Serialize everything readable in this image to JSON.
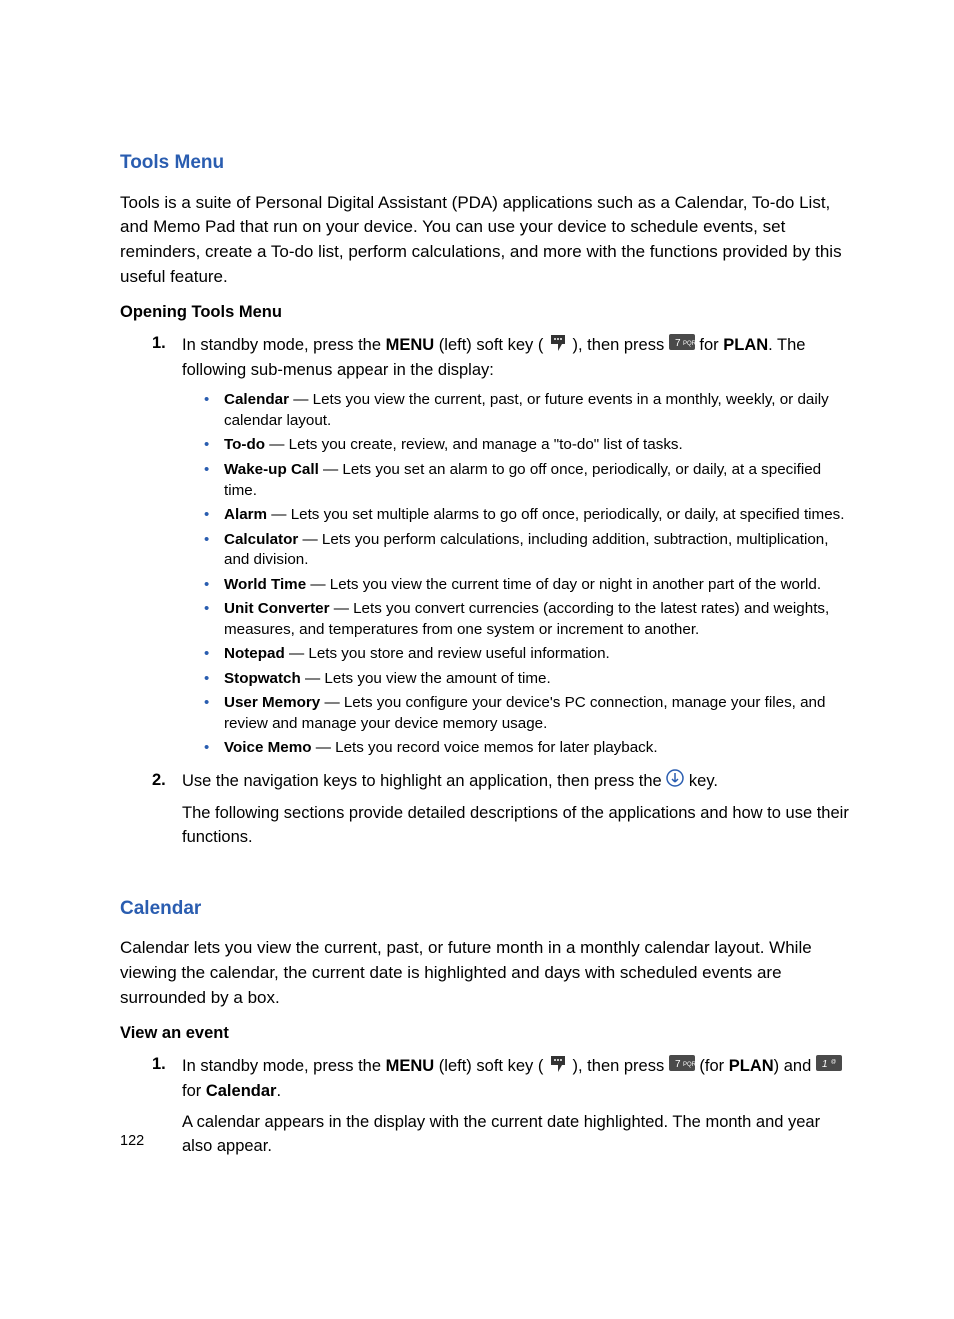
{
  "pageNumber": "122",
  "toolsMenu": {
    "heading": "Tools Menu",
    "intro": "Tools is a suite of Personal Digital Assistant (PDA) applications such as a Calendar, To-do List, and Memo Pad that run on your device. You can use your device to schedule events, set reminders, create a To-do list, perform calculations, and more with the functions provided by this useful feature.",
    "subheading": "Opening Tools Menu",
    "step1": {
      "text_a": "In standby mode, press the ",
      "menu_bold": "MENU",
      "text_b": " (left) soft key (",
      "text_c": "), then press ",
      "text_d": " for ",
      "plan_bold": "PLAN",
      "text_e": ". The following sub-menus appear in the display:"
    },
    "submenus": [
      {
        "name": "Calendar",
        "desc": " — Lets you view the current, past, or future events in a monthly, weekly, or daily calendar layout."
      },
      {
        "name": "To-do",
        "desc": " — Lets you create, review, and manage a \"to-do\" list of tasks."
      },
      {
        "name": "Wake-up Call",
        "desc": " — Lets you set an alarm to go off once, periodically, or daily, at a specified time."
      },
      {
        "name": "Alarm",
        "desc": " — Lets you set multiple alarms to go off once, periodically, or daily, at specified times."
      },
      {
        "name": "Calculator",
        "desc": " — Lets you perform calculations, including addition, subtraction, multiplication, and division."
      },
      {
        "name": "World Time",
        "desc": " — Lets you view the current time of day or night in another part of the world."
      },
      {
        "name": "Unit Converter",
        "desc": " — Lets you convert currencies (according to the latest rates) and weights, measures, and temperatures from one system or increment to another."
      },
      {
        "name": "Notepad",
        "desc": " — Lets you store and review useful information."
      },
      {
        "name": "Stopwatch",
        "desc": " — Lets you view the amount of time."
      },
      {
        "name": "User Memory",
        "desc": " — Lets you configure your device's PC connection, manage your files, and review and manage your device memory usage."
      },
      {
        "name": "Voice Memo",
        "desc": " — Lets you record voice memos for later playback."
      }
    ],
    "step2": {
      "text_a": "Use the navigation keys to highlight an application, then press the ",
      "text_b": " key.",
      "following": "The following sections provide detailed descriptions of the applications and how to use their functions."
    }
  },
  "calendar": {
    "heading": "Calendar",
    "intro": "Calendar lets you view the current, past, or future month in a monthly calendar layout. While viewing the calendar, the current date is highlighted and days with scheduled events are surrounded by a box.",
    "subheading": "View an event",
    "step1": {
      "text_a": "In standby mode, press the ",
      "menu_bold": "MENU",
      "text_b": " (left) soft key (",
      "text_c": "), then press ",
      "text_d": " (for ",
      "plan_bold": "PLAN",
      "text_e": ") and ",
      "text_f": " for ",
      "calendar_bold": "Calendar",
      "text_g": ".",
      "following": "A calendar appears in the display with the current date highlighted. The month and year also appear."
    }
  }
}
